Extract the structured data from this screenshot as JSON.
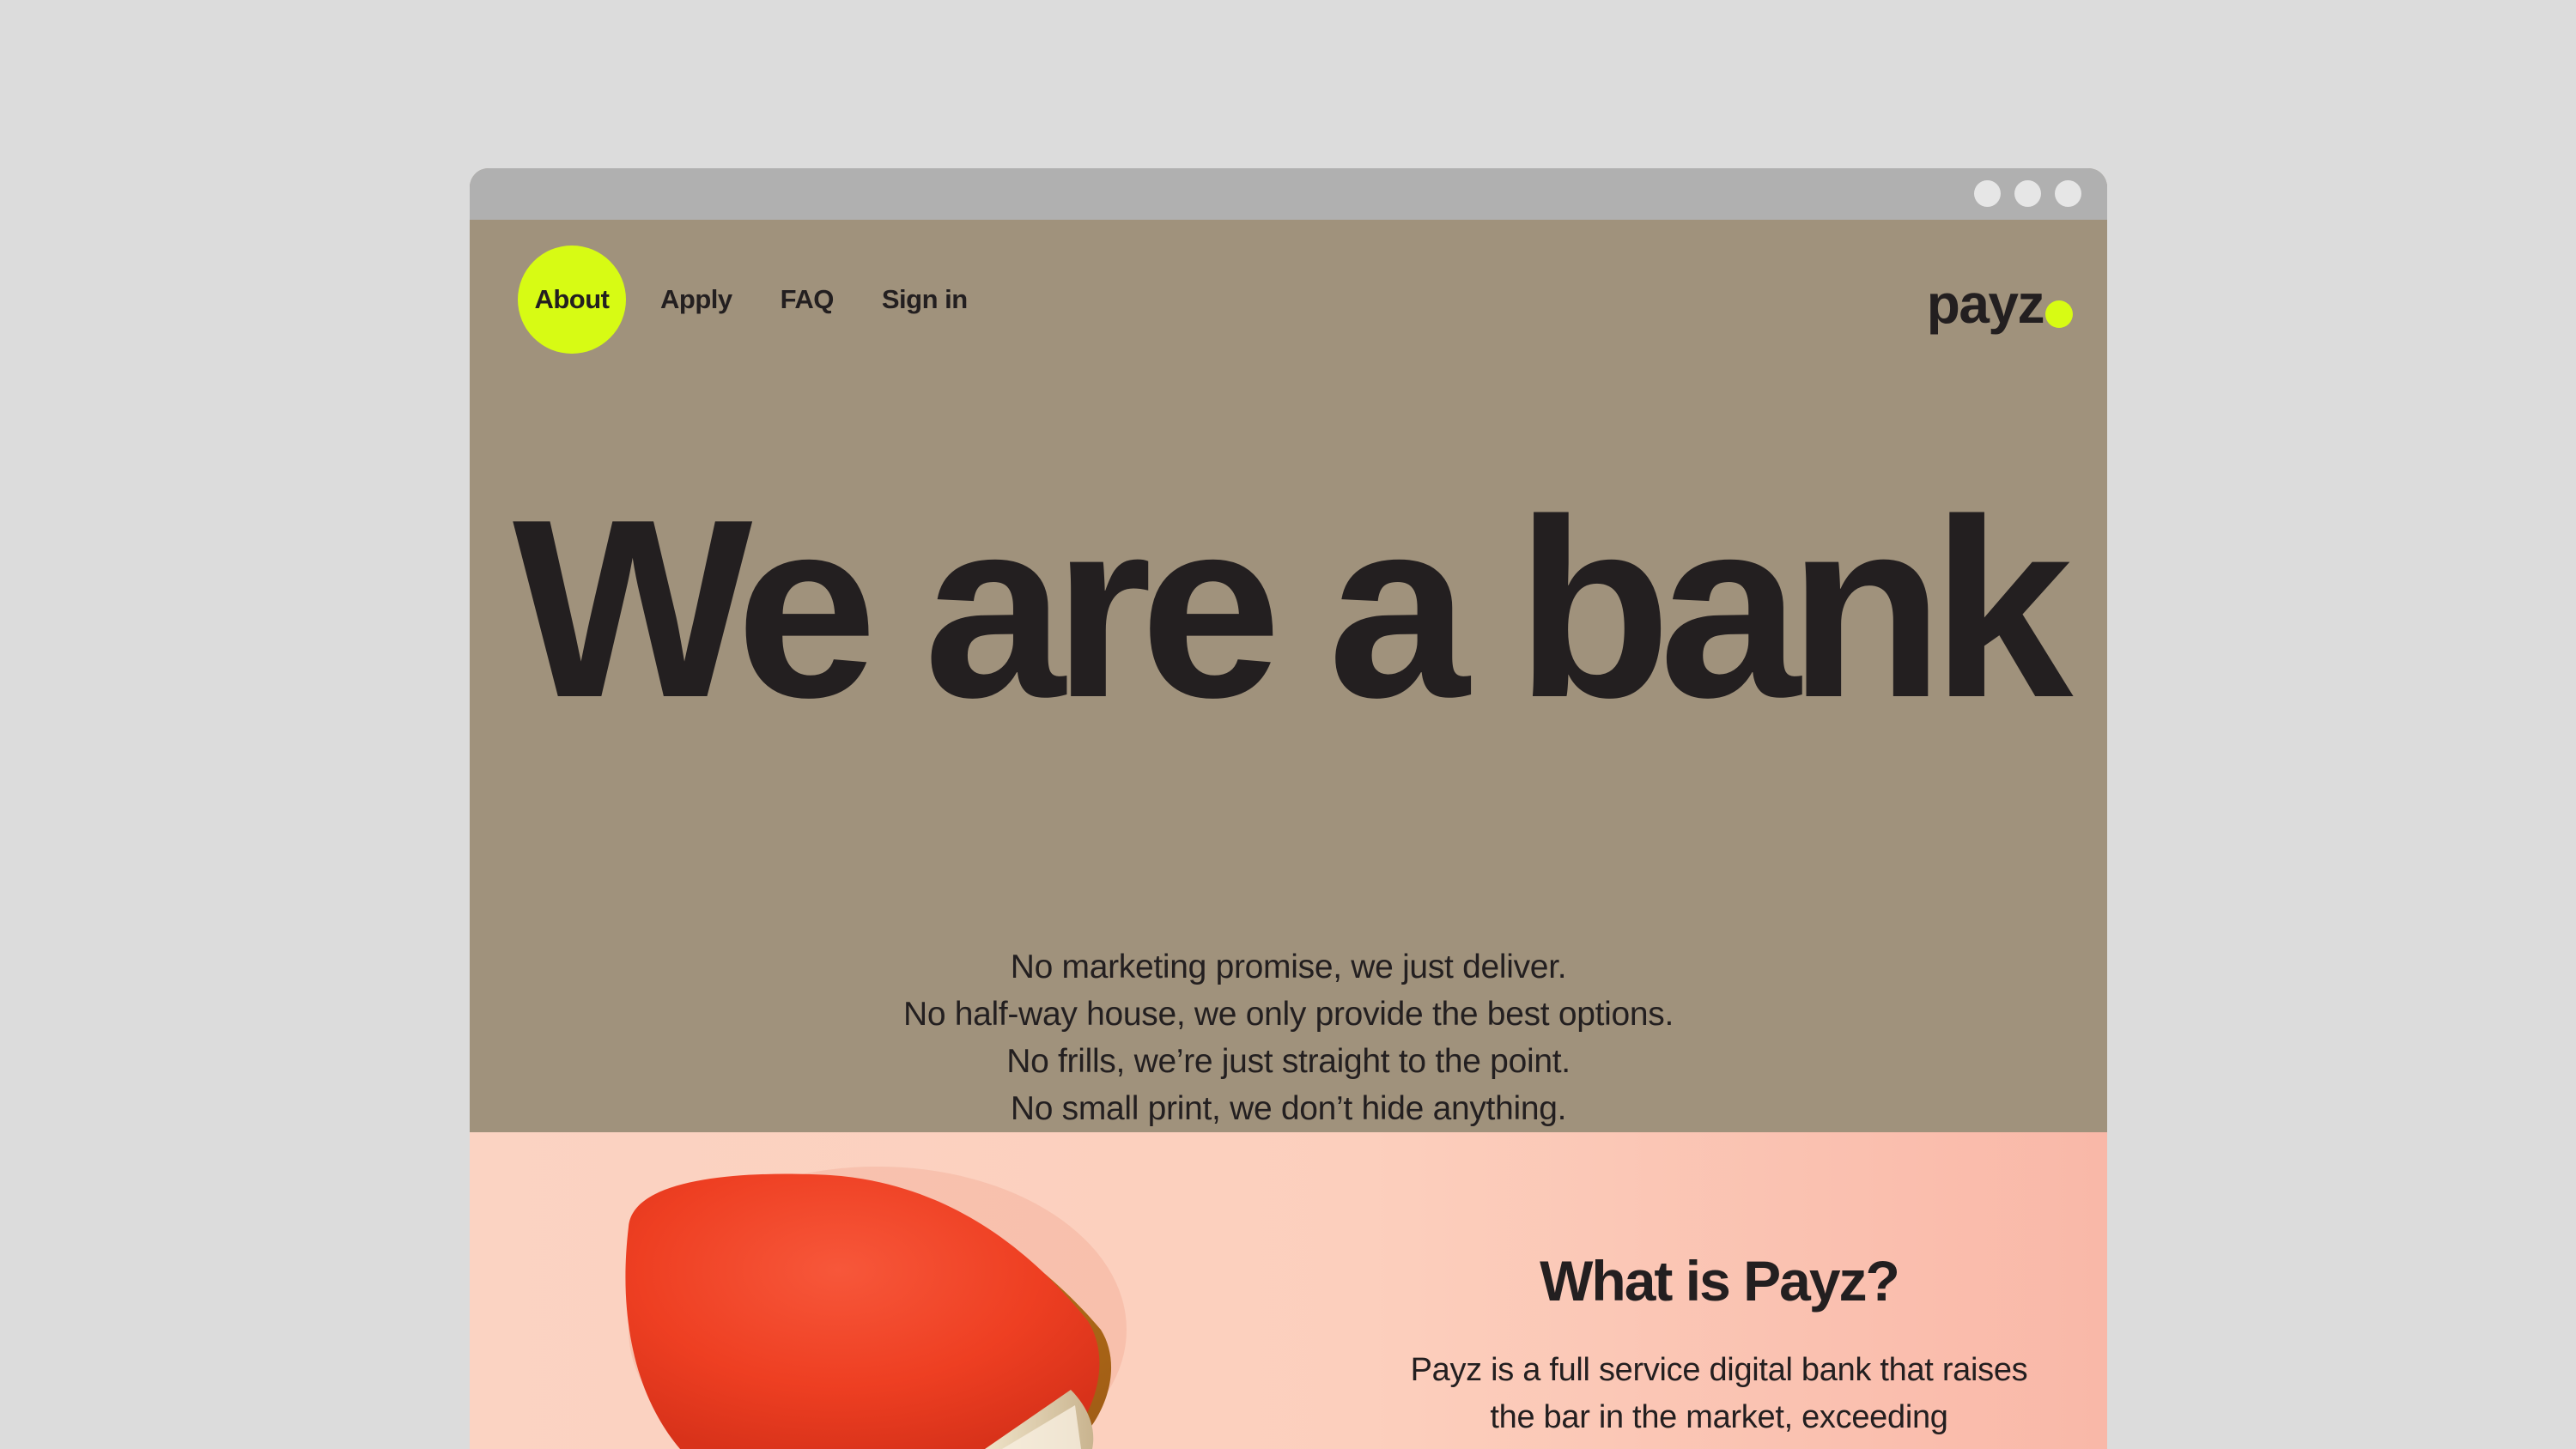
{
  "nav": {
    "items": [
      {
        "label": "About",
        "active": true
      },
      {
        "label": "Apply",
        "active": false
      },
      {
        "label": "FAQ",
        "active": false
      },
      {
        "label": "Sign in",
        "active": false
      }
    ]
  },
  "brand": {
    "logo_text": "payz",
    "accent_color": "#d7fb14"
  },
  "hero": {
    "headline": "We are a bank",
    "tagline": [
      "No marketing promise, we just deliver.",
      "No half-way house, we only provide the best options.",
      "No frills, we’re just straight to the point.",
      "No small print, we don’t hide anything."
    ],
    "background_color": "#a0927c"
  },
  "about_section": {
    "title": "What is Payz?",
    "body_lines": [
      "Payz is a full service digital bank that raises",
      "the bar in the market, exceeding"
    ],
    "image": "table-tennis-paddle-illustration"
  }
}
